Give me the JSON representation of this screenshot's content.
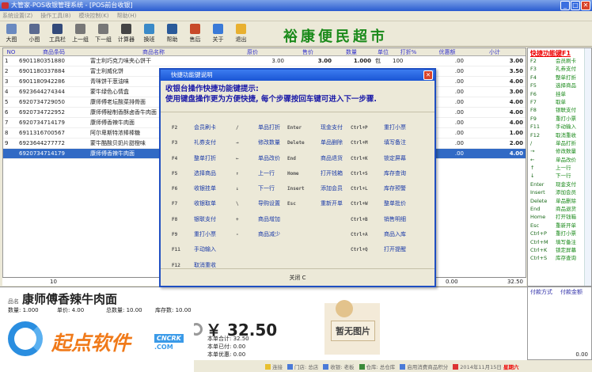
{
  "window": {
    "title": "大管家-POS收银管理系统  -  [POS前台收银]",
    "buttons": [
      "_",
      "□",
      "✕"
    ]
  },
  "menu": [
    "系统设置(Z)",
    "操作工具(B)",
    "模块控制(K)",
    "帮助(H)"
  ],
  "toolbar": [
    {
      "label": "大图",
      "color": "#6a8ac0"
    },
    {
      "label": "小图",
      "color": "#5a6a90"
    },
    {
      "label": "工具栏",
      "color": "#334a7a"
    },
    {
      "label": "上一组",
      "color": "#777"
    },
    {
      "label": "下一组",
      "color": "#777"
    },
    {
      "label": "计算器",
      "color": "#444"
    },
    {
      "label": "换班",
      "color": "#3a8ac8"
    },
    {
      "label": "帮助",
      "color": "#2a5a9a"
    },
    {
      "label": "售后",
      "color": "#c84a2a"
    },
    {
      "label": "关于",
      "color": "#3a7ad8"
    },
    {
      "label": "退出",
      "color": "#e8b030"
    }
  ],
  "banner": "裕康便民超市",
  "table": {
    "headers": [
      "NO",
      "商品条码",
      "商品名称",
      "原价",
      "售价",
      "数量",
      "单位",
      "打折%",
      "优惠额",
      "小计"
    ],
    "rows": [
      [
        "1",
        "6901180351880",
        "富士利巧克力味夹心饼干",
        "3.00",
        "3.00",
        "1.000",
        "包",
        "100",
        ".00",
        "3.00"
      ],
      [
        "2",
        "6901180337884",
        "富士利威化饼",
        "3.50",
        "3.50",
        "1.000",
        "个",
        "100",
        ".00",
        "3.50"
      ],
      [
        "3",
        "6901180942286",
        "青咪饼干葱油味",
        "",
        "",
        "",
        "",
        "",
        ".00",
        "4.00"
      ],
      [
        "4",
        "6923644274344",
        "蒙牛绿色心情盒",
        "",
        "",
        "",
        "",
        "",
        ".00",
        "3.00"
      ],
      [
        "5",
        "6920734729050",
        "康师傅老坛酸菜排骨面",
        "",
        "",
        "",
        "",
        "",
        ".00",
        "4.00"
      ],
      [
        "6",
        "6920734722952",
        "康师傅秘制香酥卤香牛肉面",
        "",
        "",
        "",
        "",
        "",
        ".00",
        "4.00"
      ],
      [
        "7",
        "6920734714179",
        "康师傅香辣牛肉面",
        "",
        "",
        "",
        "",
        "",
        ".00",
        "4.00"
      ],
      [
        "8",
        "6911316700567",
        "阿尔卑斯特浓棒棒糖",
        "",
        "",
        "",
        "",
        "",
        ".00",
        "1.00"
      ],
      [
        "9",
        "6923644277772",
        "蒙牛酷酸贝奶片甜橙味",
        "",
        "",
        "",
        "",
        "",
        ".00",
        "2.00"
      ],
      [
        "",
        "6920734714179",
        "康师傅香辣牛肉面",
        "",
        "",
        "",
        "",
        "",
        ".00",
        "4.00"
      ]
    ],
    "selected_row": 9,
    "footer": {
      "count": "10",
      "discount": "0.00",
      "total": "32.50"
    }
  },
  "shortcuts_panel": {
    "title": "快捷功能键F1",
    "items": [
      [
        "F2",
        "会员刷卡"
      ],
      [
        "F3",
        "礼券支付"
      ],
      [
        "F4",
        "整单打折"
      ],
      [
        "F5",
        "选择商品"
      ],
      [
        "F6",
        "挂单"
      ],
      [
        "F7",
        "取单"
      ],
      [
        "F8",
        "银联支付"
      ],
      [
        "F9",
        "重打小票"
      ],
      [
        "F11",
        "手动输入"
      ],
      [
        "F12",
        "取消重收"
      ],
      [
        "/",
        "单品打折"
      ],
      [
        "→",
        "修改数量"
      ],
      [
        "←",
        "单品改价"
      ],
      [
        "↑",
        "上一行"
      ],
      [
        "↓",
        "下一行"
      ],
      [
        "Enter",
        "现金支付"
      ],
      [
        "Insert",
        "添加会员"
      ],
      [
        "Delete",
        "单品删除"
      ],
      [
        "End",
        "商品退货"
      ],
      [
        "Home",
        "打开钱箱"
      ],
      [
        "Esc",
        "重新开单"
      ],
      [
        "Ctrl+P",
        "重打小票"
      ],
      [
        "Ctrl+M",
        "填写备注"
      ],
      [
        "Ctrl+K",
        "锁定屏幕"
      ],
      [
        "Ctrl+S",
        "库存查询"
      ]
    ]
  },
  "payment": {
    "method_label": "付款方式",
    "amount_label": "付款金额",
    "total": "0.00"
  },
  "product": {
    "name_label": "品名",
    "name": "康师傅香辣牛肉面",
    "qty": "数量: 1.000",
    "price": "单价: 4.00",
    "total_qty": "总数量: 10.00",
    "stock": "库存数: 10.00",
    "no_image": "暂无图片"
  },
  "totals": {
    "amount": "￥ 32.50",
    "order_total": "本单合计:  32.50",
    "paid": "本单已付:  0.00",
    "discount": "本单优惠:  0.00"
  },
  "watermark": {
    "text": "起点软件",
    "brand": "CNCRK",
    ".com": ".COM"
  },
  "status": {
    "connect": "连接",
    "store": "门店: 总店",
    "cashier": "收银: 老板",
    "warehouse": "仓库: 总仓库",
    "points": "启用消费商品积分",
    "date": "2014年11月15日",
    "weekday": "星期六"
  },
  "dialog": {
    "title": "快捷功能键说明",
    "intro1": "收银台操作快捷功能键提示:",
    "intro2": "使用键盘操作更为方便快捷, 每个步骤按回车键可进入下一步骤.",
    "close": "关闭 C",
    "columns": [
      [
        [
          "F2",
          "会员刷卡"
        ],
        [
          "F3",
          "礼券支付"
        ],
        [
          "F4",
          "整单打折"
        ],
        [
          "F5",
          "选择商品"
        ],
        [
          "F6",
          "收银挂单"
        ],
        [
          "F7",
          "收银取单"
        ],
        [
          "F8",
          "银联支付"
        ],
        [
          "F9",
          "重打小票"
        ],
        [
          "F11",
          "手动输入"
        ],
        [
          "F12",
          "取消重收"
        ]
      ],
      [
        [
          "/",
          "单品打折"
        ],
        [
          "→",
          "修改数量"
        ],
        [
          "←",
          "单品改价"
        ],
        [
          "↑",
          "上一行"
        ],
        [
          "↓",
          "下一行"
        ],
        [
          "\\",
          "导购设置"
        ],
        [
          "+",
          "商品增加"
        ],
        [
          "-",
          "商品减少"
        ]
      ],
      [
        [
          "Enter",
          "现金支付"
        ],
        [
          "Delete",
          "单品删除"
        ],
        [
          "End",
          "商品退货"
        ],
        [
          "Home",
          "打开钱箱"
        ],
        [
          "Insert",
          "添加会员"
        ],
        [
          "Esc",
          "重新开单"
        ]
      ],
      [
        [
          "Ctrl+P",
          "重打小票"
        ],
        [
          "Ctrl+M",
          "填写备注"
        ],
        [
          "Ctrl+K",
          "锁定屏幕"
        ],
        [
          "Ctrl+S",
          "库存查询"
        ],
        [
          "Ctrl+L",
          "库存预警"
        ],
        [
          "Ctrl+W",
          "整单批价"
        ],
        [
          "Ctrl+B",
          "销售明细"
        ],
        [
          "Ctrl+A",
          "商品入库"
        ],
        [
          "Ctrl+Q",
          "打开提醒"
        ]
      ]
    ]
  }
}
